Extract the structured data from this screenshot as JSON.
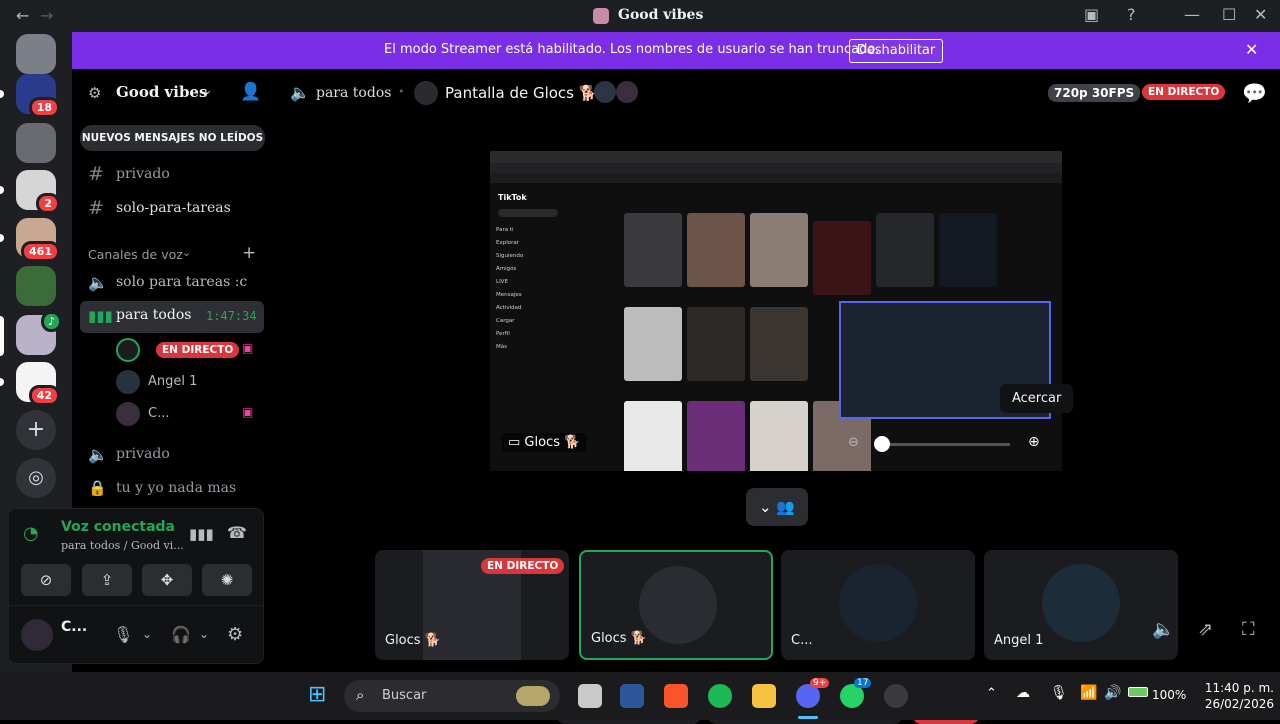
{
  "window": {
    "title": "Good vibes"
  },
  "banner": {
    "message": "El modo Streamer está habilitado. Los nombres de usuario se han truncado.",
    "button": "Deshabilitar"
  },
  "guild_badges": [
    "18",
    "2",
    "461",
    "42"
  ],
  "sidebar": {
    "server_name": "Good vibes",
    "new_messages": "NUEVOS MENSAJES NO LEÍDOS",
    "text_channels": [
      "privado",
      "solo-para-tareas"
    ],
    "voice_category": "Canales de voz",
    "voice_channels": {
      "solo": "solo para tareas :c",
      "active": "para todos",
      "active_timer": "1:47:34",
      "privado": "privado",
      "locked": "tu y yo nada mas"
    },
    "voice_users": {
      "live_label": "EN DIRECTO",
      "user2": "Angel 1",
      "user3": "C..."
    }
  },
  "voice_panel": {
    "status": "Voz conectada",
    "location": "para todos / Good vi...",
    "username": "C..."
  },
  "header": {
    "channel": "para todos",
    "stream_title": "Pantalla de Glocs 🐕",
    "quality": "720p 30FPS",
    "live": "EN DIRECTO"
  },
  "stream": {
    "tiktok_brand": "TikTok",
    "tiktok_nav": [
      "Para ti",
      "Explorar",
      "Siguiendo",
      "Amigos",
      "LIVE",
      "Mensajes",
      "Actividad",
      "Cargar",
      "Perfil",
      "Más"
    ],
    "streamer_label": "Glocs 🐕",
    "zoom_tooltip": "Acercar"
  },
  "tiles": [
    {
      "label": "Glocs 🐕",
      "live": "EN DIRECTO"
    },
    {
      "label": "Glocs 🐕"
    },
    {
      "label": "C..."
    },
    {
      "label": "Angel 1"
    }
  ],
  "taskbar": {
    "search": "Buscar",
    "discord_badge": "9+",
    "whatsapp_badge": "17",
    "battery": "100%",
    "time": "11:40 p. m.",
    "date": "26/02/2026"
  },
  "colors": {
    "banner": "#7a2ee6",
    "live": "#da373c",
    "connected": "#23a55a",
    "end_call": "#da373c"
  }
}
